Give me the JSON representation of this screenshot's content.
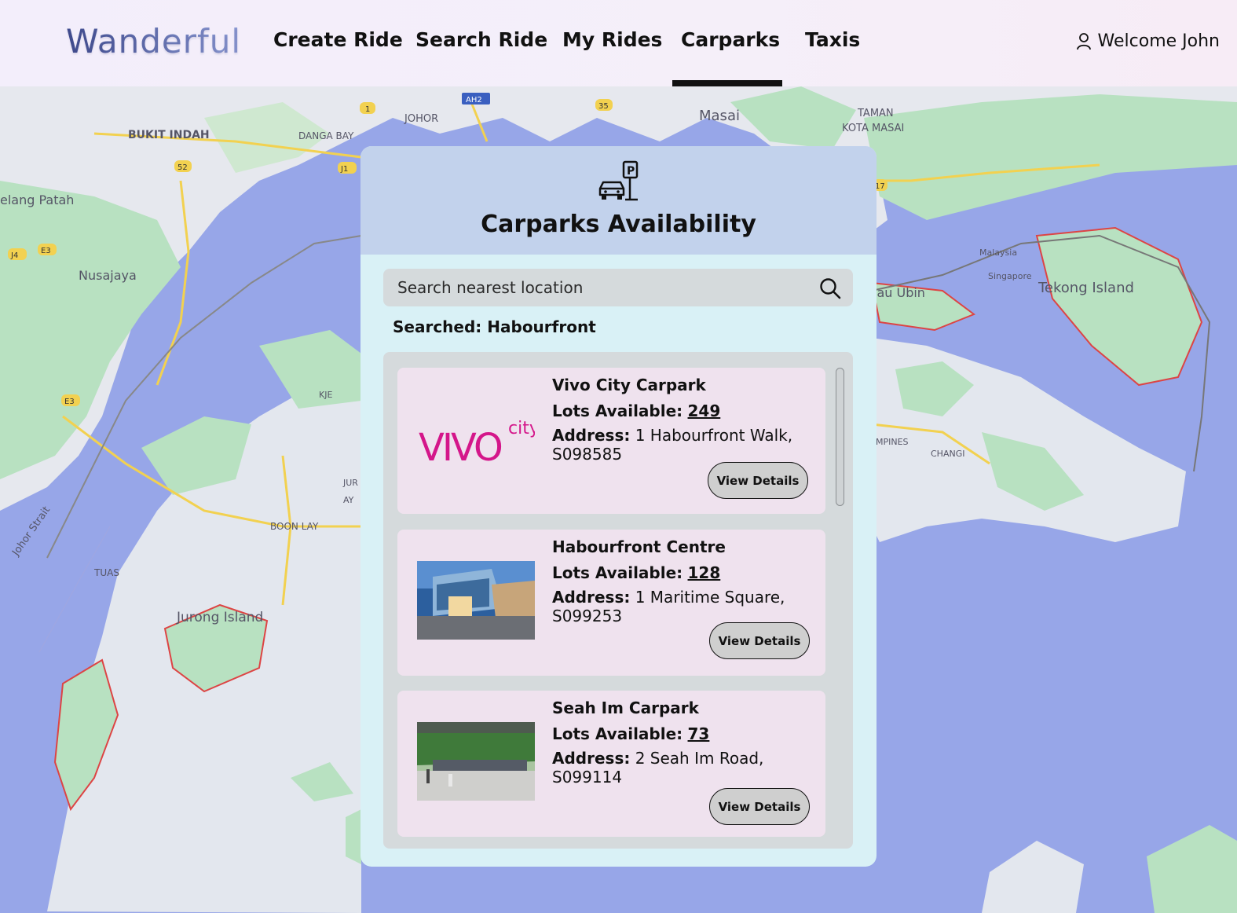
{
  "header": {
    "logo": "Wanderful",
    "nav": [
      {
        "label": "Create Ride"
      },
      {
        "label": "Search Ride"
      },
      {
        "label": "My Rides"
      },
      {
        "label": "Carparks",
        "active": true
      },
      {
        "label": "Taxis"
      }
    ],
    "welcome": "Welcome John"
  },
  "map": {
    "labels": [
      "BUKIT INDAH",
      "DANGA BAY",
      "JOHOR",
      "Masai",
      "TAMAN",
      "KOTA MASAI",
      "elang Patah",
      "Nusajaya",
      "Malaysia",
      "Singapore",
      "Tekong Island",
      "lau Ubin",
      "Johor Strait",
      "BOON LAY",
      "TUAS",
      "Jurong Island",
      "MPINES",
      "CHANGI",
      "KJE",
      "JUR",
      "AY"
    ],
    "road_badges": [
      "AH2",
      "1",
      "35",
      "52",
      "J1",
      "E3",
      "J4",
      "17",
      "E3"
    ]
  },
  "panel": {
    "title": "Carparks Availability",
    "search_placeholder": "Search nearest location",
    "searched_label": "Searched: Habourfront",
    "lots_label": "Lots Available:",
    "address_label": "Address:",
    "view_details": "View Details",
    "carparks": [
      {
        "name": "Vivo City Carpark",
        "lots": "249",
        "address": "1 Habourfront Walk, S098585",
        "logo_text": "VIVO",
        "logo_sup": "city"
      },
      {
        "name": "Habourfront Centre",
        "lots": "128",
        "address": "1 Maritime Square, S099253"
      },
      {
        "name": "Seah Im Carpark",
        "lots": "73",
        "address": "2 Seah Im Road, S099114"
      }
    ]
  },
  "colors": {
    "water": "#97a6e8",
    "land": "#e3e7ee",
    "park": "#b9e3c2",
    "panel_head": "#c2d2ec",
    "panel_body": "#d9f1f6",
    "card": "#efe2ee",
    "vivo_magenta": "#d4168a"
  }
}
